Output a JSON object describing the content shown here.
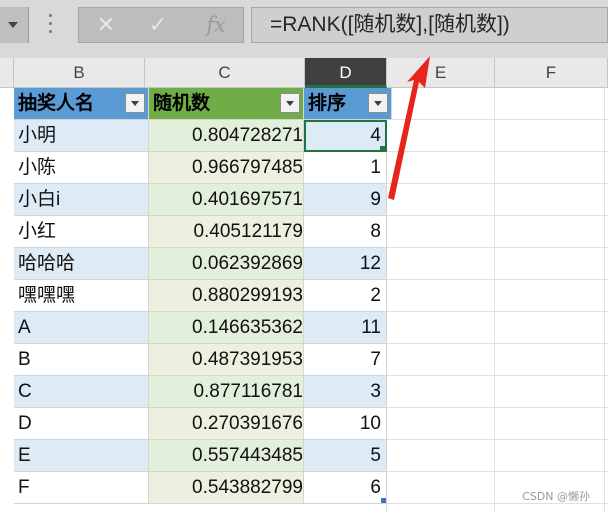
{
  "formula_bar": {
    "cancel_symbol": "✕",
    "enter_symbol": "✓",
    "fx_label": "fx",
    "formula": "=RANK([随机数],[随机数])"
  },
  "columns": [
    "B",
    "C",
    "D",
    "E",
    "F"
  ],
  "selected_column": "D",
  "table": {
    "headers": [
      "抽奖人名",
      "随机数",
      "排序"
    ],
    "rows": [
      [
        "小明",
        "0.804728271",
        "4"
      ],
      [
        "小陈",
        "0.966797485",
        "1"
      ],
      [
        "小白i",
        "0.401697571",
        "9"
      ],
      [
        "小红",
        "0.405121179",
        "8"
      ],
      [
        "哈哈哈",
        "0.062392869",
        "12"
      ],
      [
        "嘿嘿嘿",
        "0.880299193",
        "2"
      ],
      [
        "A",
        "0.146635362",
        "11"
      ],
      [
        "B",
        "0.487391953",
        "7"
      ],
      [
        "C",
        "0.877116781",
        "3"
      ],
      [
        "D",
        "0.270391676",
        "10"
      ],
      [
        "E",
        "0.557443485",
        "5"
      ],
      [
        "F",
        "0.543882799",
        "6"
      ]
    ]
  },
  "colors": {
    "header_blue": "#5b9bd5",
    "header_green": "#70ad47",
    "band_blue": "#ddebf7",
    "selection_green": "#217346",
    "arrow_red": "#e8251b"
  },
  "watermark": "CSDN @懒孙"
}
